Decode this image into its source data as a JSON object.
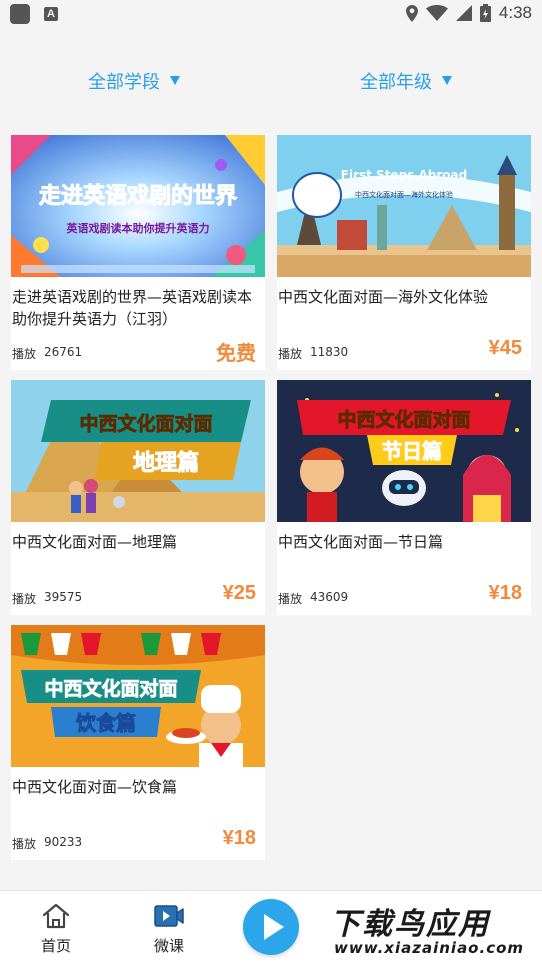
{
  "status_bar": {
    "time": "4:38",
    "icons": [
      "app-square-icon",
      "a-badge-icon",
      "location-icon",
      "wifi-icon",
      "signal-icon",
      "battery-icon"
    ]
  },
  "filters": {
    "stage": "全部学段",
    "grade": "全部年级",
    "accent_color": "#2b9fe6"
  },
  "play_label": "播放",
  "courses": [
    {
      "title": "走进英语戏剧的世界—英语戏剧读本助你提升英语力（江羽）",
      "plays": "26761",
      "price": "免费",
      "thumb_title": "走进英语戏剧的世界",
      "thumb_sub": "英语戏剧读本助你提升英语力"
    },
    {
      "title": "中西文化面对面—海外文化体验",
      "plays": "11830",
      "price": "¥45",
      "thumb_title": "First Steps Abroad",
      "thumb_sub": "中西文化面对面—海外文化体验"
    },
    {
      "title": "中西文化面对面—地理篇",
      "plays": "39575",
      "price": "¥25",
      "thumb_title": "中西文化面对面",
      "thumb_sub": "地理篇"
    },
    {
      "title": "中西文化面对面—节日篇",
      "plays": "43609",
      "price": "¥18",
      "thumb_title": "中西文化面对面",
      "thumb_sub": "节日篇"
    },
    {
      "title": "中西文化面对面—饮食篇",
      "plays": "90233",
      "price": "¥18",
      "thumb_title": "中西文化面对面",
      "thumb_sub": "饮食篇"
    }
  ],
  "price_color": "#f28a3c",
  "nav": {
    "home": "首页",
    "course": "微课"
  },
  "watermark": {
    "top": "下载鸟应用",
    "bottom": "www.xiazainiao.com"
  }
}
